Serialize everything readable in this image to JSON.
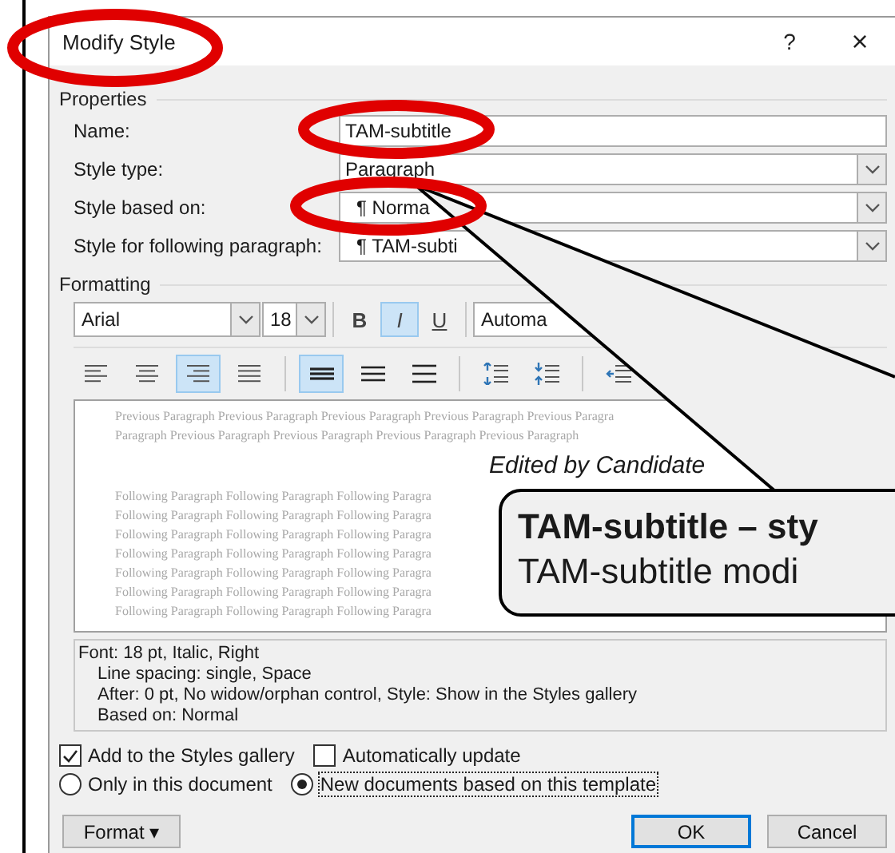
{
  "window": {
    "title": "Modify Style",
    "help": "?",
    "close": "×"
  },
  "properties": {
    "label": "Properties",
    "fields": [
      {
        "label": "Name:",
        "value": "TAM-subtitle",
        "kind": "text"
      },
      {
        "label": "Style type:",
        "value": "Paragraph",
        "kind": "dropdown"
      },
      {
        "label": "Style based on:",
        "value": "¶ Norma",
        "kind": "dropdown"
      },
      {
        "label": "Style for following paragraph:",
        "value": "¶ TAM-subti",
        "kind": "dropdown"
      }
    ]
  },
  "formatting": {
    "label": "Formatting",
    "font": "Arial",
    "size": "18",
    "color_value": "Automa",
    "styles": [
      {
        "label": "B",
        "kind": "bold",
        "selected": false
      },
      {
        "label": "I",
        "kind": "italic",
        "selected": true
      },
      {
        "label": "U",
        "kind": "underline",
        "selected": false
      }
    ],
    "alignment": [
      {
        "kind": "left",
        "selected": false
      },
      {
        "kind": "center",
        "selected": false
      },
      {
        "kind": "right",
        "selected": true
      },
      {
        "kind": "justify",
        "selected": false
      }
    ],
    "spacing": [
      {
        "kind": "single",
        "selected": true
      },
      {
        "kind": "one-half",
        "selected": false
      },
      {
        "kind": "double",
        "selected": false
      }
    ]
  },
  "preview": {
    "previous": [
      "Previous Paragraph Previous Paragraph Previous Paragraph Previous Paragraph Previous Paragra",
      "Paragraph Previous Paragraph Previous Paragraph Previous Paragraph Previous Paragraph"
    ],
    "current": "Edited by Candidate",
    "following": [
      "Following Paragraph Following Paragraph Following Paragra",
      "Following Paragraph Following Paragraph Following Paragra",
      "Following Paragraph Following Paragraph Following Paragra",
      "Following Paragraph Following Paragraph Following Paragra",
      "Following Paragraph Following Paragraph Following Paragra",
      "Following Paragraph Following Paragraph Following Paragra",
      "Following Paragraph Following Paragraph Following Paragra"
    ]
  },
  "description": [
    "Font: 18 pt, Italic, Right",
    "Line spacing:  single, Space",
    "After:  0 pt, No widow/orphan control, Style: Show in the Styles gallery",
    "Based on: Normal"
  ],
  "checkboxes": [
    {
      "label": "Add to the Styles gallery",
      "checked": true
    },
    {
      "label": "Automatically update",
      "checked": false
    }
  ],
  "radios": [
    {
      "label": "Only in this document",
      "selected": false,
      "focused": false
    },
    {
      "label": "New documents based on this template",
      "selected": true,
      "focused": true
    }
  ],
  "format_button": {
    "label": "Format",
    "caret": "▾"
  },
  "buttons": [
    {
      "label": "OK",
      "default": true
    },
    {
      "label": "Cancel",
      "default": false
    }
  ],
  "callout": {
    "title": "TAM-subtitle – sty",
    "text": "TAM-subtitle modi"
  }
}
